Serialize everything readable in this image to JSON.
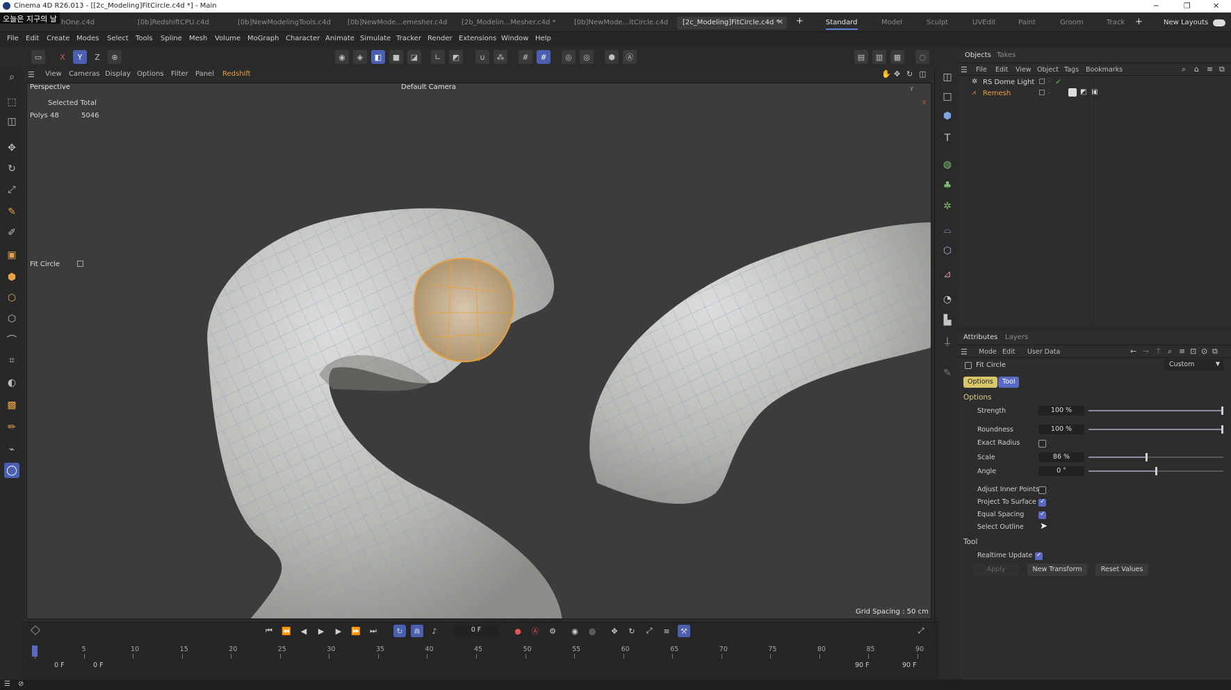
{
  "titlebar": {
    "title": "Cinema 4D R26.013 - [[2c_Modeling]FitCircle.c4d *] - Main",
    "overlay_label": "오늘은 지구의 날"
  },
  "tabs": [
    {
      "label": "hOne.c4d"
    },
    {
      "label": "[0b]RedshiftCPU.c4d"
    },
    {
      "label": "[0b]NewModelingTools.c4d"
    },
    {
      "label": "[0b]NewMode...emesher.c4d"
    },
    {
      "label": "[2b_Modelin...Mesher.c4d *"
    },
    {
      "label": "[0b]NewMode...itCircle.c4d"
    },
    {
      "label": "[2c_Modeling]FitCircle.c4d *"
    }
  ],
  "layouts": [
    "Standard",
    "Model",
    "Sculpt",
    "UVEdit",
    "Paint",
    "Groom",
    "Track"
  ],
  "new_layouts": "New Layouts",
  "menus": [
    "File",
    "Edit",
    "Create",
    "Modes",
    "Select",
    "Tools",
    "Spline",
    "Mesh",
    "Volume",
    "MoGraph",
    "Character",
    "Animate",
    "Simulate",
    "Tracker",
    "Render",
    "Extensions",
    "Window",
    "Help"
  ],
  "axes": {
    "x": "X",
    "y": "Y",
    "z": "Z"
  },
  "viewport": {
    "menus": [
      "View",
      "Cameras",
      "Display",
      "Options",
      "Filter",
      "Panel",
      "Redshift"
    ],
    "projection": "Perspective",
    "camera": "Default Camera",
    "stats_title": "Selected Total",
    "stats_label": "Polys",
    "stats_selected": "48",
    "stats_total": "5046",
    "tool_label": "Fit Circle",
    "grid_spacing": "Grid Spacing : 50 cm",
    "axis_y": "Y",
    "axis_x": "X"
  },
  "objects_panel": {
    "tabs": [
      "Objects",
      "Takes"
    ],
    "menus": [
      "File",
      "Edit",
      "View",
      "Object",
      "Tags",
      "Bookmarks"
    ],
    "items": [
      {
        "name": "RS Dome Light"
      },
      {
        "name": "Remesh"
      }
    ]
  },
  "attributes_panel": {
    "tabs": [
      "Attributes",
      "Layers"
    ],
    "menus": [
      "Mode",
      "Edit",
      "User Data"
    ],
    "tool_name": "Fit Circle",
    "preset": "Custom",
    "subtabs": [
      "Options",
      "Tool"
    ],
    "section_options": "Options",
    "strength": {
      "label": "Strength",
      "value": "100 %",
      "fraction": 1.0
    },
    "roundness": {
      "label": "Roundness",
      "value": "100 %",
      "fraction": 1.0
    },
    "exact_radius": {
      "label": "Exact Radius",
      "checked": false
    },
    "scale": {
      "label": "Scale",
      "value": "86 %",
      "fraction": 0.43
    },
    "angle": {
      "label": "Angle",
      "value": "0 °",
      "fraction": 0.5
    },
    "adjust_inner_points": {
      "label": "Adjust Inner Points",
      "checked": false
    },
    "project_to_surface": {
      "label": "Project To Surface",
      "checked": true
    },
    "equal_spacing": {
      "label": "Equal Spacing",
      "checked": true
    },
    "select_outline": {
      "label": "Select Outline"
    },
    "section_tool": "Tool",
    "realtime_update": {
      "label": "Realtime Update",
      "checked": true
    },
    "apply": "Apply",
    "new_transform": "New Transform",
    "reset_values": "Reset Values"
  },
  "timeline": {
    "current_frame": "0 F",
    "ticks": [
      "0",
      "5",
      "10",
      "15",
      "20",
      "25",
      "30",
      "35",
      "40",
      "45",
      "50",
      "55",
      "60",
      "65",
      "70",
      "75",
      "80",
      "85",
      "90"
    ],
    "start_frame": "0 F",
    "start_frame2": "0 F",
    "end_frame": "90 F",
    "end_frame2": "90 F"
  },
  "colors": {
    "accent": "#5969c4",
    "selection": "#e8a040",
    "mesh_wire": "#6fa0c8"
  }
}
